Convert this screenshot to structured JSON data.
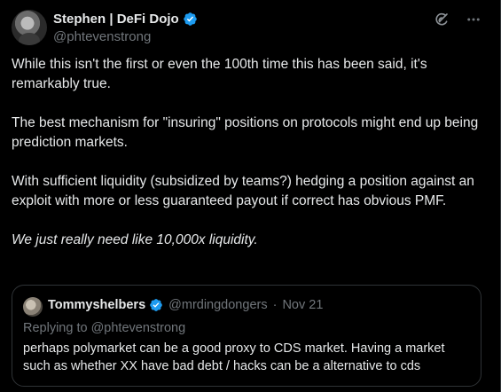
{
  "author": {
    "name": "Stephen | DeFi Dojo",
    "handle": "@phtevenstrong",
    "verified": true
  },
  "post": {
    "paragraphs": [
      "While this isn't the first or even the 100th time this has been said, it's remarkably true.",
      "The best mechanism for \"insuring\" positions on protocols might end up being prediction markets.",
      "With sufficient liquidity (subsidized by teams?) hedging a position against an exploit with more or less guaranteed payout if correct has obvious PMF.",
      "We just really need like 10,000x liquidity."
    ]
  },
  "quote": {
    "name": "Tommyshelbers",
    "handle": "@mrdingdongers",
    "separator": "·",
    "date": "Nov 21",
    "replying_to": "Replying to @phtevenstrong",
    "text": "perhaps polymarket can be a good proxy to CDS market. Having a market such as whether XX have bad debt / hacks can be a alternative to cds"
  },
  "icons": {
    "verified": "verified-badge-icon",
    "grok": "grok-icon",
    "more": "more-icon"
  },
  "colors": {
    "background": "#000000",
    "text": "#e7e9ea",
    "muted": "#71767b",
    "verified": "#1d9bf0",
    "border": "#2f3336"
  }
}
